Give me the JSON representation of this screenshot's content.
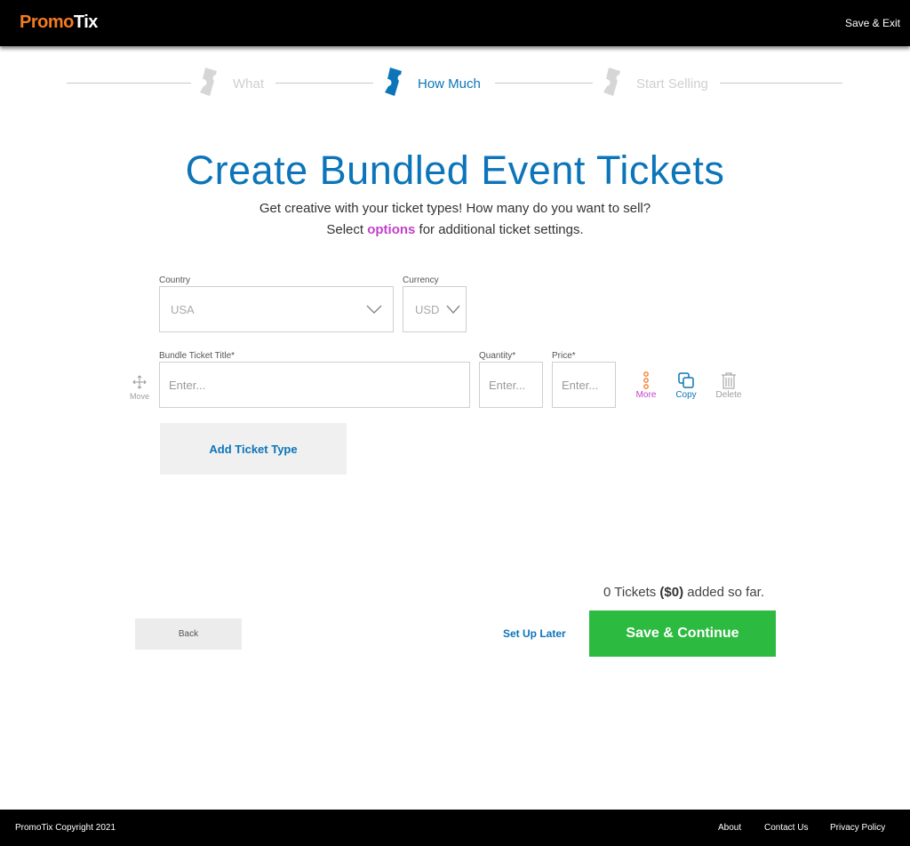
{
  "header": {
    "logo_part1": "Promo",
    "logo_part2": "Tix",
    "save_exit": "Save & Exit"
  },
  "stepper": {
    "steps": [
      {
        "label": "What",
        "state": "inactive"
      },
      {
        "label": "How Much",
        "state": "active"
      },
      {
        "label": "Start Selling",
        "state": "inactive"
      }
    ]
  },
  "main": {
    "title": "Create Bundled Event Tickets",
    "subtitle_line1": "Get creative with your ticket types! How many do you want to sell?",
    "subtitle_line2_pre": "Select ",
    "subtitle_line2_link": "options",
    "subtitle_line2_post": " for additional ticket settings."
  },
  "form": {
    "country_label": "Country",
    "country_value": "USA",
    "currency_label": "Currency",
    "currency_value": "USD",
    "title_label": "Bundle Ticket Title*",
    "title_placeholder": "Enter...",
    "quantity_label": "Quantity*",
    "quantity_placeholder": "Enter...",
    "price_label": "Price*",
    "price_placeholder": "Enter...",
    "move_label": "Move",
    "more_label": "More",
    "copy_label": "Copy",
    "delete_label": "Delete",
    "add_ticket_label": "Add Ticket Type"
  },
  "summary": {
    "count_text": "0 Tickets ",
    "amount": "($0)",
    "suffix": " added so far."
  },
  "actions": {
    "back": "Back",
    "setup_later": "Set Up Later",
    "save_continue": "Save & Continue"
  },
  "footer": {
    "copyright": "PromoTix Copyright 2021",
    "links": [
      "About",
      "Contact Us",
      "Privacy Policy"
    ]
  },
  "colors": {
    "brand_blue": "#0c75b9",
    "brand_orange": "#f47b20",
    "accent_purple": "#c441c9",
    "success_green": "#2dba41"
  },
  "icons": {
    "step": "ticket-icon",
    "select": "chevron-down-icon",
    "move": "move-icon",
    "more": "more-dots-icon",
    "copy": "copy-icon",
    "delete": "trash-icon"
  }
}
